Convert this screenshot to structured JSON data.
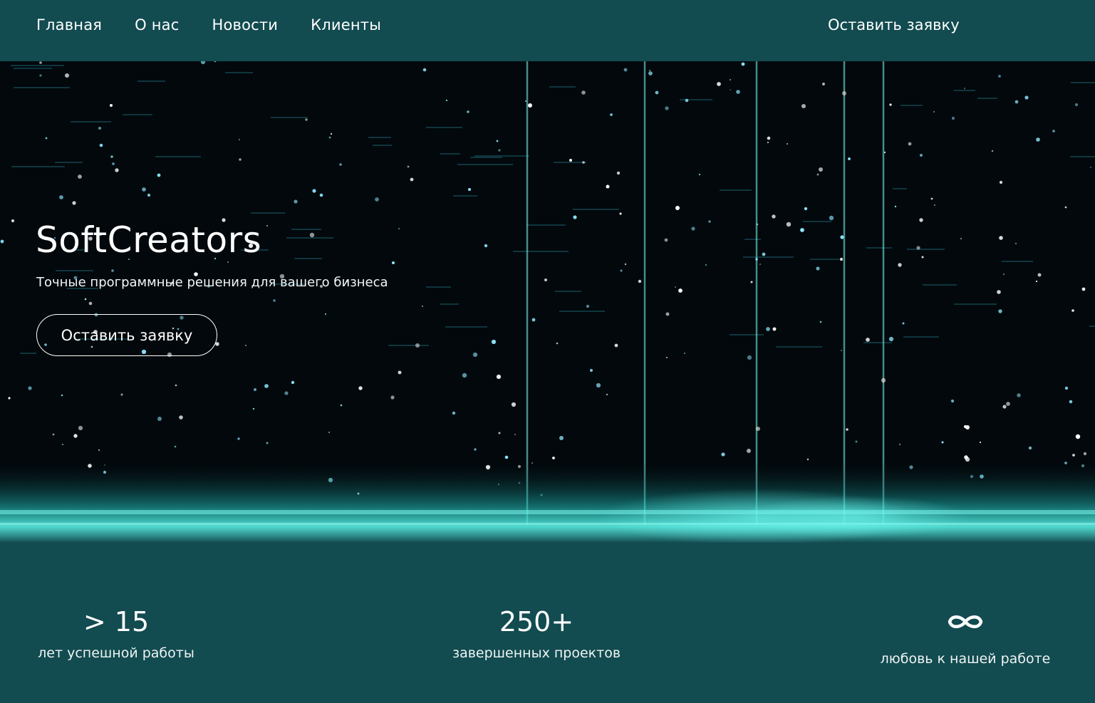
{
  "nav": {
    "items": [
      "Главная",
      "О нас",
      "Новости",
      "Клиенты"
    ],
    "cta": "Оставить заявку"
  },
  "hero": {
    "title": "SoftCreators",
    "subtitle": "Точные программные решения для вашего бизнеса",
    "button": "Оставить заявку",
    "background_image": "neon-circuit-lines"
  },
  "stats": [
    {
      "value": "> 15",
      "label": "лет успешной работы"
    },
    {
      "value": "250+",
      "label": "завершенных проектов"
    },
    {
      "value": "",
      "icon": "infinity-icon",
      "label": "любовь к нашей работе"
    }
  ],
  "colors": {
    "background": "#124b50",
    "hero_dark": "#02080c",
    "accent": "#3fe6e0"
  }
}
